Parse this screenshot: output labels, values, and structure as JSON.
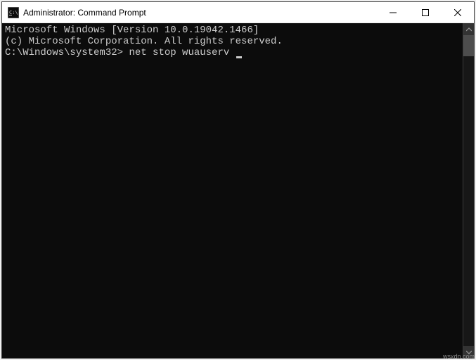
{
  "window": {
    "title": "Administrator: Command Prompt"
  },
  "terminal": {
    "line1": "Microsoft Windows [Version 10.0.19042.1466]",
    "line2": "(c) Microsoft Corporation. All rights reserved.",
    "blank": "",
    "prompt": "C:\\Windows\\system32>",
    "command": "net stop wuauserv"
  },
  "watermark": "wsxdn.com"
}
